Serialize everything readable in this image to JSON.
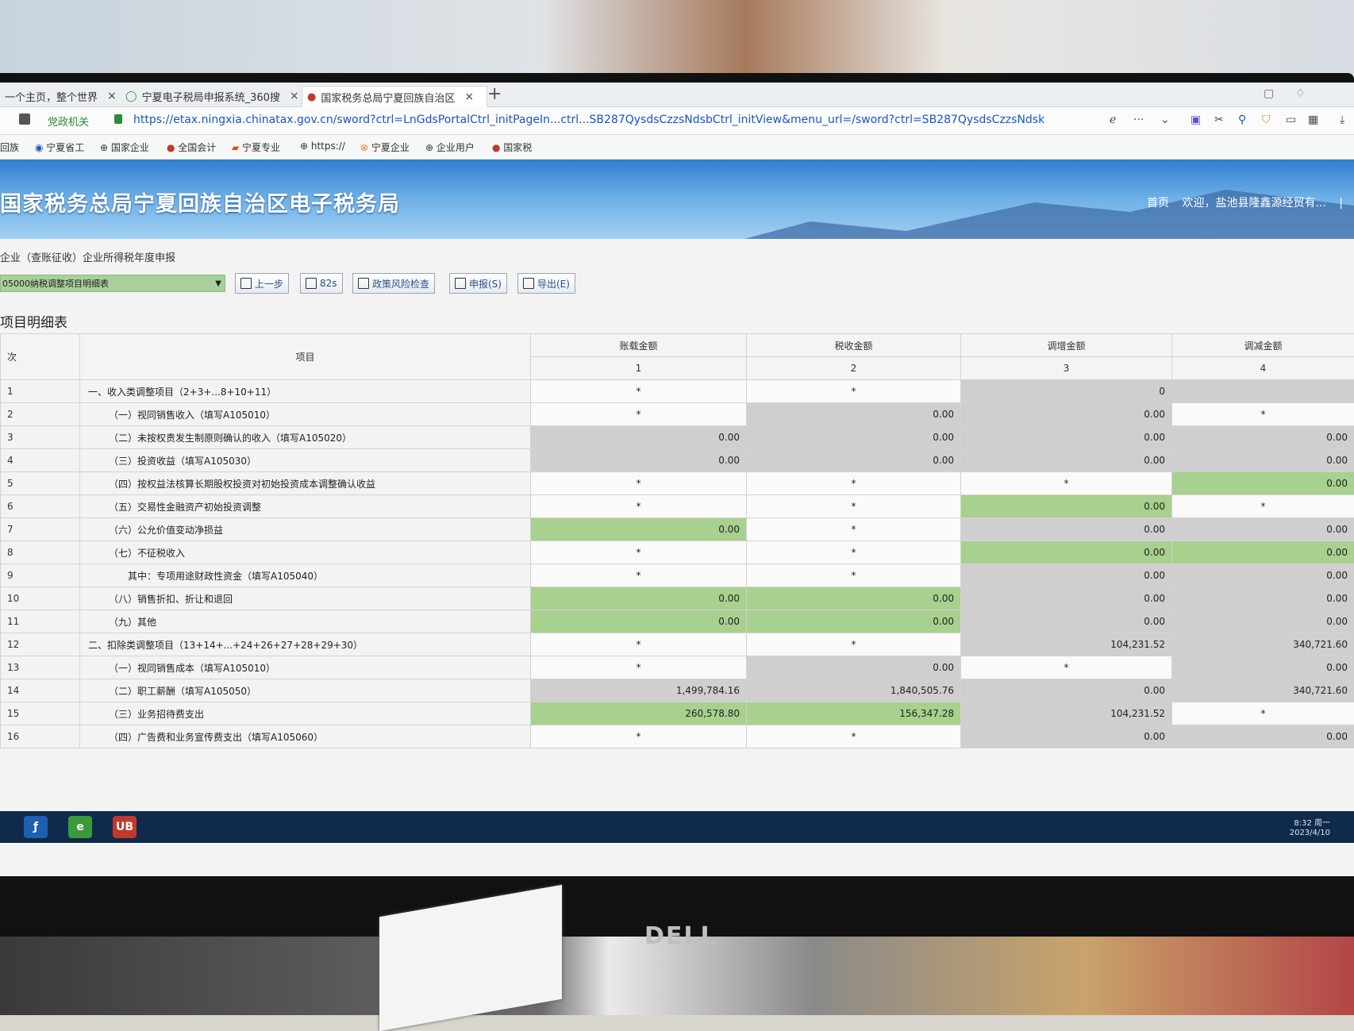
{
  "browser": {
    "tabs": [
      {
        "label": "一个主页，整个世界"
      },
      {
        "label": "宁夏电子税局申报系统_360搜"
      },
      {
        "label": "国家税务总局宁夏回族自治区"
      }
    ],
    "close_symbol": "×",
    "new_tab_symbol": "+",
    "address_prefix": "党政机关",
    "url": "https://etax.ningxia.chinatax.gov.cn/sword?ctrl=LnGdsPortalCtrl_initPageIn...ctrl...SB287QysdsCzzsNdsbCtrl_initView&menu_url=/sword?ctrl=SB287QysdsCzzsNdsk",
    "bookmarks": [
      "回族",
      "宁夏省工",
      "国家企业",
      "全国会计",
      "宁夏专业",
      "https://",
      "宁夏企业",
      "企业用户",
      "国家税"
    ]
  },
  "banner": {
    "title": "国家税务总局宁夏回族自治区电子税务局",
    "nav_home": "首页",
    "nav_welcome": "欢迎，盐池县隆鑫源经贸有...",
    "nav_sep": "|"
  },
  "breadcrumb": "企业（查账征收）企业所得税年度申报",
  "toolbar": {
    "form_select": "05000纳税调整项目明细表",
    "prev_label": "上一步",
    "save_label": "82s",
    "risk_label": "政策风险检查",
    "submit_label": "申报(S)",
    "export_label": "导出(E)"
  },
  "sheet_title": "项目明细表",
  "table": {
    "headers": {
      "idx": "次",
      "item": "项目",
      "col1": "账载金额",
      "col2": "税收金额",
      "col3": "调增金额",
      "col4": "调减金额",
      "n1": "1",
      "n2": "2",
      "n3": "3",
      "n4": "4"
    },
    "rows": [
      {
        "idx": "1",
        "item": "一、收入类调整项目（2+3+...8+10+11）",
        "c1": "*",
        "c2": "*",
        "c3": "0",
        "c4": ""
      },
      {
        "idx": "2",
        "item": "（一）视同销售收入（填写A105010）",
        "c1": "*",
        "c2": "0.00",
        "c3": "0.00",
        "c4": "*"
      },
      {
        "idx": "3",
        "item": "（二）未按权责发生制原则确认的收入（填写A105020）",
        "c1": "0.00",
        "c2": "0.00",
        "c3": "0.00",
        "c4": "0.00"
      },
      {
        "idx": "4",
        "item": "（三）投资收益（填写A105030）",
        "c1": "0.00",
        "c2": "0.00",
        "c3": "0.00",
        "c4": "0.00"
      },
      {
        "idx": "5",
        "item": "（四）按权益法核算长期股权投资对初始投资成本调整确认收益",
        "c1": "*",
        "c2": "*",
        "c3": "*",
        "c4": "0.00"
      },
      {
        "idx": "6",
        "item": "（五）交易性金融资产初始投资调整",
        "c1": "*",
        "c2": "*",
        "c3": "0.00",
        "c4": "*"
      },
      {
        "idx": "7",
        "item": "（六）公允价值变动净损益",
        "c1": "0.00",
        "c2": "*",
        "c3": "0.00",
        "c4": "0.00"
      },
      {
        "idx": "8",
        "item": "（七）不征税收入",
        "c1": "*",
        "c2": "*",
        "c3": "0.00",
        "c4": "0.00"
      },
      {
        "idx": "9",
        "item": "其中：专项用途财政性资金（填写A105040）",
        "c1": "*",
        "c2": "*",
        "c3": "0.00",
        "c4": "0.00"
      },
      {
        "idx": "10",
        "item": "（八）销售折扣、折让和退回",
        "c1": "0.00",
        "c2": "0.00",
        "c3": "0.00",
        "c4": "0.00"
      },
      {
        "idx": "11",
        "item": "（九）其他",
        "c1": "0.00",
        "c2": "0.00",
        "c3": "0.00",
        "c4": "0.00"
      },
      {
        "idx": "12",
        "item": "二、扣除类调整项目（13+14+...+24+26+27+28+29+30）",
        "c1": "*",
        "c2": "*",
        "c3": "104,231.52",
        "c4": "340,721.60"
      },
      {
        "idx": "13",
        "item": "（一）视同销售成本（填写A105010）",
        "c1": "*",
        "c2": "0.00",
        "c3": "*",
        "c4": "0.00"
      },
      {
        "idx": "14",
        "item": "（二）职工薪酬（填写A105050）",
        "c1": "1,499,784.16",
        "c2": "1,840,505.76",
        "c3": "0.00",
        "c4": "340,721.60"
      },
      {
        "idx": "15",
        "item": "（三）业务招待费支出",
        "c1": "260,578.80",
        "c2": "156,347.28",
        "c3": "104,231.52",
        "c4": "*"
      },
      {
        "idx": "16",
        "item": "（四）广告费和业务宣传费支出（填写A105060）",
        "c1": "*",
        "c2": "*",
        "c3": "0.00",
        "c4": "0.00"
      }
    ],
    "cell_styles": [
      [
        "white",
        "white",
        "gray",
        "gray"
      ],
      [
        "white",
        "gray",
        "gray",
        "white"
      ],
      [
        "gray",
        "gray",
        "gray",
        "gray"
      ],
      [
        "gray",
        "gray",
        "gray",
        "gray"
      ],
      [
        "white",
        "white",
        "white",
        "green"
      ],
      [
        "white",
        "white",
        "green",
        "white"
      ],
      [
        "green",
        "white",
        "gray",
        "gray"
      ],
      [
        "white",
        "white",
        "green",
        "green"
      ],
      [
        "white",
        "white",
        "gray",
        "gray"
      ],
      [
        "green",
        "green",
        "gray",
        "gray"
      ],
      [
        "green",
        "green",
        "gray",
        "gray"
      ],
      [
        "white",
        "white",
        "gray",
        "gray"
      ],
      [
        "white",
        "gray",
        "white",
        "gray"
      ],
      [
        "gray",
        "gray",
        "gray",
        "gray"
      ],
      [
        "green",
        "green",
        "gray",
        "white"
      ],
      [
        "white",
        "white",
        "gray",
        "gray"
      ]
    ]
  },
  "taskbar": {
    "time": "8:32 周一",
    "date": "2023/4/10",
    "app_badge": "UB"
  },
  "monitor_brand": "DELL",
  "colors": {
    "editable_green": "#a8d08e",
    "readonly_gray": "#cfcfcf",
    "banner_blue": "#2f7fcf"
  }
}
